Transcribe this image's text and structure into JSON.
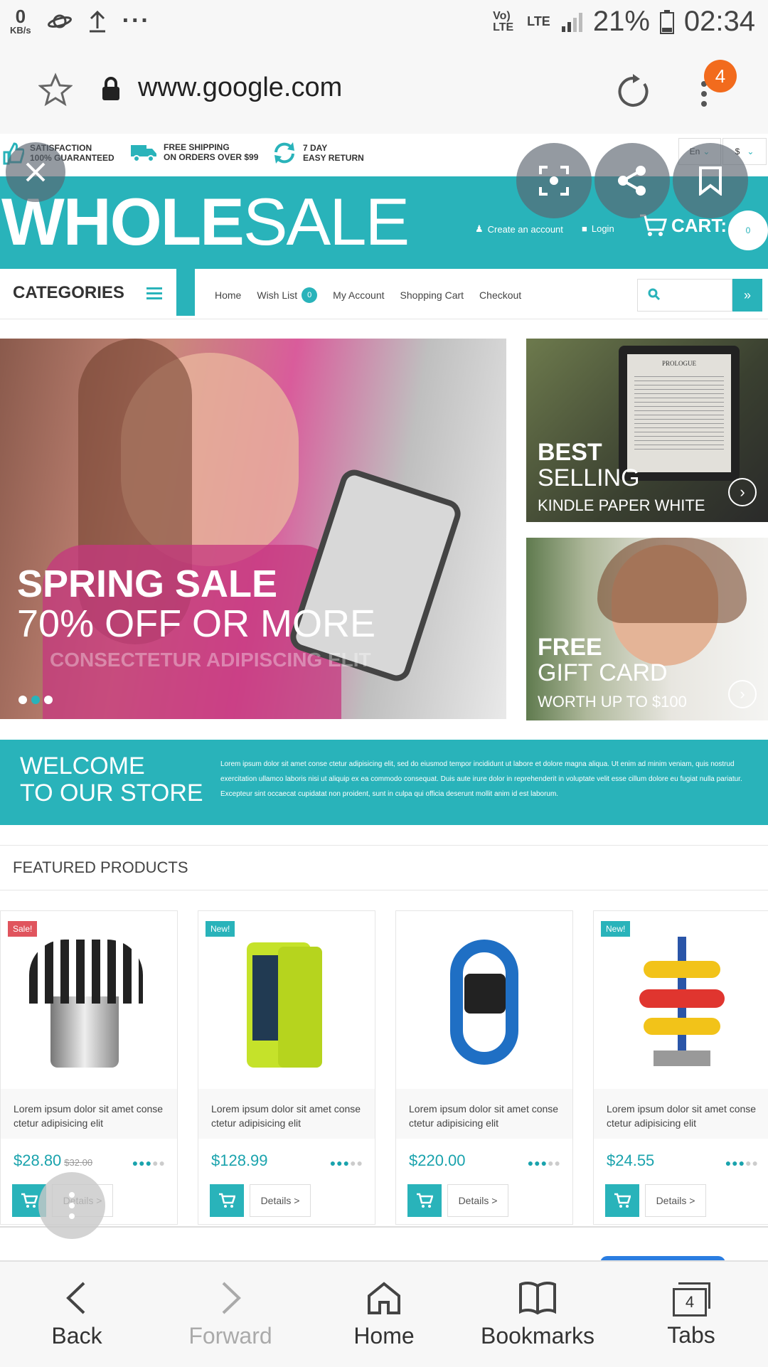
{
  "status_bar": {
    "net_speed_value": "0",
    "net_speed_unit": "KB/s",
    "more": "···",
    "volte": "Vo) LTE",
    "lte": "LTE",
    "battery": "21%",
    "time": "02:34"
  },
  "address_bar": {
    "url": "www.google.com",
    "menu_badge": "4"
  },
  "site": {
    "features": [
      {
        "line1": "SATISFACTION",
        "line2": "100% GUARANTEED"
      },
      {
        "line1": "FREE SHIPPING",
        "line2": "ON ORDERS OVER $99"
      },
      {
        "line1": "7 DAY",
        "line2": "EASY RETURN"
      }
    ],
    "lang": "En",
    "currency": "$",
    "logo_bold": "WHOLE",
    "logo_light": "SALE",
    "create_account": "Create an account",
    "login": "Login",
    "cart_label": "CART:",
    "cart_count": "0",
    "categories": "CATEGORIES",
    "nav": [
      "Home",
      "Wish List",
      "My Account",
      "Shopping Cart",
      "Checkout"
    ],
    "wishlist_count": "0",
    "hero": {
      "line1": "SPRING SALE",
      "line2": "70% OFF OR MORE",
      "line3": "CONSECTETUR ADIPISCING ELIT"
    },
    "banner1": {
      "line1": "BEST",
      "line2": "SELLING",
      "line3": "KINDLE PAPER WHITE",
      "book": "PROLOGUE"
    },
    "banner2": {
      "line1": "FREE",
      "line2": "GIFT CARD",
      "line3": "WORTH UP TO $100"
    },
    "welcome_line1": "WELCOME",
    "welcome_line2": "TO OUR STORE",
    "welcome_text": "Lorem ipsum dolor sit amet conse ctetur adipisicing elit, sed do eiusmod tempor incididunt ut labore et dolore magna aliqua. Ut enim ad minim veniam, quis nostrud exercitation ullamco laboris nisi ut aliquip ex ea commodo consequat. Duis aute irure dolor in reprehenderit in voluptate velit esse cillum dolore eu fugiat nulla pariatur. Excepteur sint occaecat cupidatat non proident, sunt in culpa qui officia deserunt mollit anim id est laborum.",
    "featured_title": "FEATURED PRODUCTS",
    "products": [
      {
        "badge": "Sale!",
        "badge_color": "#e0545d",
        "desc": "Lorem ipsum dolor sit amet conse ctetur adipisicing elit",
        "price": "$28.80",
        "old_price": "$32.00",
        "details": "Details >",
        "rating": 3
      },
      {
        "badge": "New!",
        "badge_color": "#29b3ba",
        "desc": "Lorem ipsum dolor sit amet conse ctetur adipisicing elit",
        "price": "$128.99",
        "old_price": "",
        "details": "Details >",
        "rating": 3
      },
      {
        "badge": "",
        "badge_color": "",
        "desc": "Lorem ipsum dolor sit amet conse ctetur adipisicing elit",
        "price": "$220.00",
        "old_price": "",
        "details": "Details >",
        "rating": 3
      },
      {
        "badge": "New!",
        "badge_color": "#29b3ba",
        "desc": "Lorem ipsum dolor sit amet conse ctetur adipisicing elit",
        "price": "$24.55",
        "old_price": "",
        "details": "Details >",
        "rating": 3
      }
    ]
  },
  "bottom_nav": {
    "back": "Back",
    "forward": "Forward",
    "home": "Home",
    "bookmarks": "Bookmarks",
    "tabs": "Tabs",
    "tab_count": "4"
  },
  "colors": {
    "teal": "#29b3ba",
    "orange_badge": "#f26b1d",
    "sale_red": "#e0545d"
  }
}
